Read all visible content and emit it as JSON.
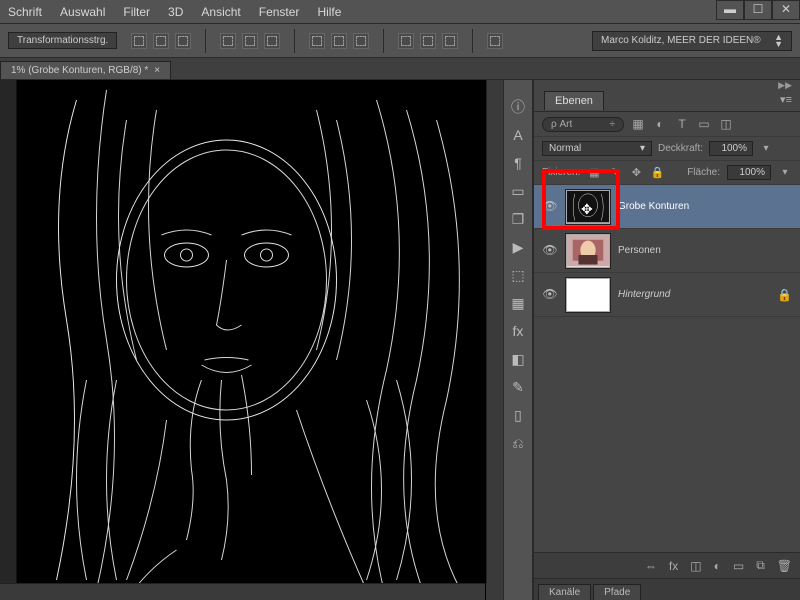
{
  "menu": [
    "Schrift",
    "Auswahl",
    "Filter",
    "3D",
    "Ansicht",
    "Fenster",
    "Hilfe"
  ],
  "window_controls": {
    "min": "▬",
    "max": "☐",
    "close": "✕"
  },
  "options": {
    "transform_label": "Transformationsstrg.",
    "credits": "Marco Kolditz, MEER DER IDEEN®"
  },
  "document_tab": "1% (Grobe Konturen, RGB/8) *",
  "panels": {
    "layers_title": "Ebenen",
    "search_placeholder": "Art",
    "blend_mode": "Normal",
    "opacity_label": "Deckkraft:",
    "opacity_value": "100%",
    "lock_label": "Fixieren:",
    "fill_label": "Fläche:",
    "fill_value": "100%",
    "layers": [
      {
        "name": "Grobe Konturen",
        "selected": true,
        "italic": false
      },
      {
        "name": "Personen",
        "selected": false,
        "italic": false
      },
      {
        "name": "Hintergrund",
        "selected": false,
        "italic": true,
        "locked": true
      }
    ],
    "footer_fx": "fx",
    "bottom_tabs": [
      "Kanäle",
      "Pfade"
    ]
  }
}
